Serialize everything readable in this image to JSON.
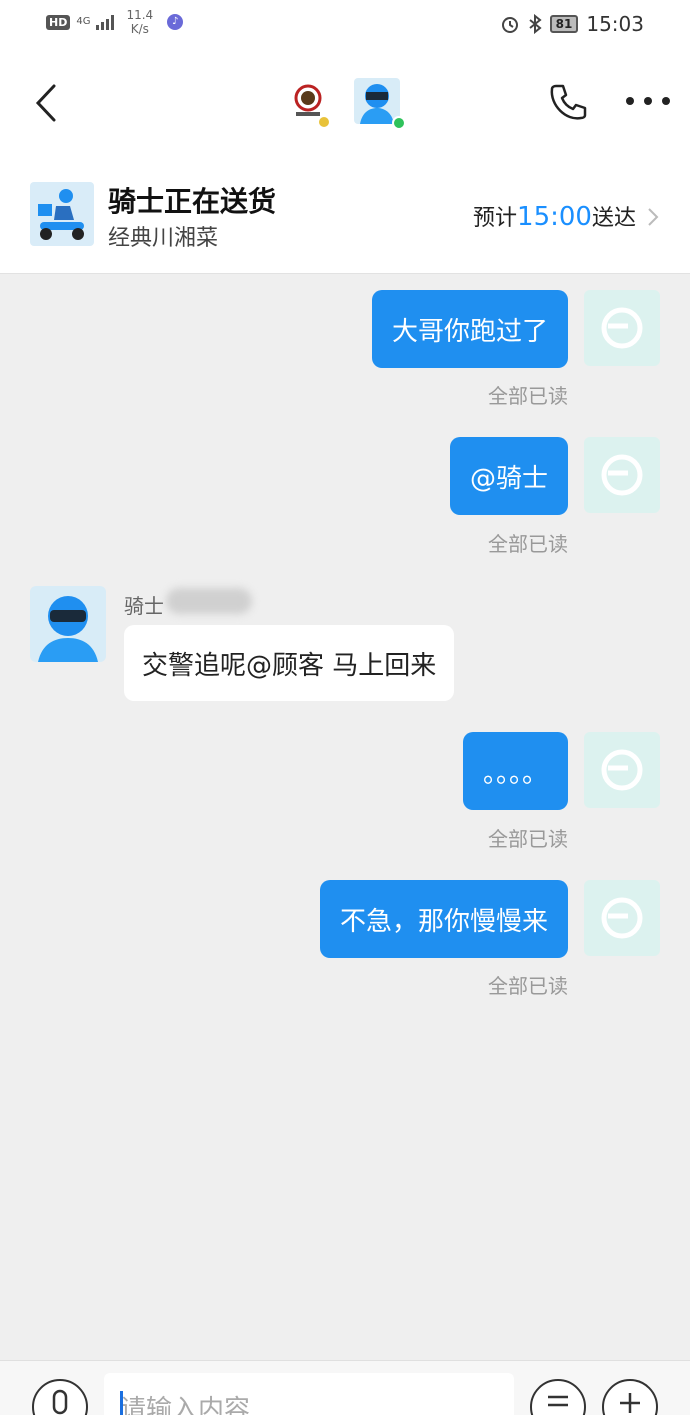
{
  "status_bar": {
    "hd": "HD",
    "network": "4G",
    "speed_value": "11.4",
    "speed_unit": "K/s",
    "battery": "81",
    "time": "15:03"
  },
  "order": {
    "title": "骑士正在送货",
    "store": "经典川湘菜",
    "eta_prefix": "预计",
    "eta_time": "15:00",
    "eta_suffix": "送达"
  },
  "messages": [
    {
      "side": "right",
      "text": "大哥你跑过了",
      "receipt": "全部已读"
    },
    {
      "side": "right",
      "text": "@骑士",
      "receipt": "全部已读"
    },
    {
      "side": "left",
      "sender": "骑士",
      "text": "交警追呢@顾客 马上回来"
    },
    {
      "side": "right",
      "text": "。。。。",
      "receipt": "全部已读"
    },
    {
      "side": "right",
      "text": "不急，那你慢慢来",
      "receipt": "全部已读"
    }
  ],
  "input": {
    "placeholder": "请输入内容"
  },
  "icons": {
    "back": "chevron-left-icon",
    "phone": "phone-icon",
    "more": "more-dots-icon",
    "mic": "microphone-icon",
    "list": "list-icon",
    "plus": "plus-icon"
  },
  "colors": {
    "bubble_blue": "#1f8ff0",
    "eta_blue": "#1a8fff",
    "background": "#efefef",
    "online_green": "#2fc25b"
  }
}
